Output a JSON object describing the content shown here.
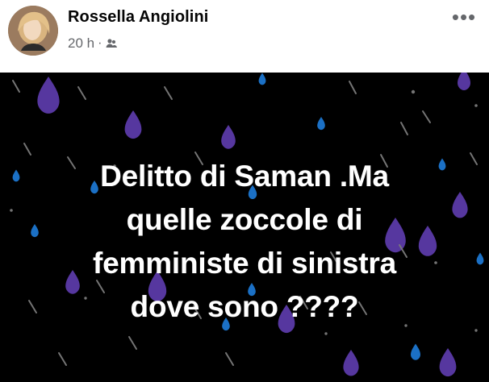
{
  "post": {
    "author": "Rossella Angiolini",
    "time": "20 h",
    "separator": "·",
    "audience_icon": "group-icon",
    "more_icon": "more-horizontal-icon",
    "more_label": "•••",
    "text_lines": [
      "Delitto di Saman .Ma",
      "quelle zoccole di",
      "femministe di sinistra",
      "dove sono ????"
    ],
    "background_color": "#000000",
    "text_color": "#ffffff",
    "accent_colors": [
      "#5b3aa8",
      "#1d77d0",
      "#7b7b7b"
    ]
  }
}
